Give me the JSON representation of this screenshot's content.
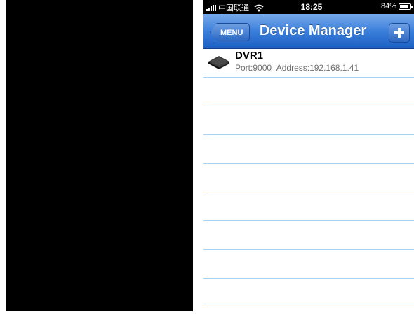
{
  "status_bar": {
    "carrier": "中国联通",
    "time": "18:25",
    "battery_percent": "84%",
    "battery_level": 0.84,
    "wifi_icon": "wifi-icon",
    "signal_icon": "signal-bars-icon"
  },
  "nav": {
    "menu_label": "MENU",
    "title": "Device Manager",
    "add_icon": "plus-icon"
  },
  "devices": [
    {
      "name": "DVR1",
      "port_label": "Port:9000",
      "address_label": "Address:192.168.1.41",
      "icon": "dvr-icon"
    }
  ],
  "colors": {
    "nav_bar": "#3b7fdb",
    "separator": "#a9d3f0",
    "detail_text": "#6e6e6e"
  }
}
